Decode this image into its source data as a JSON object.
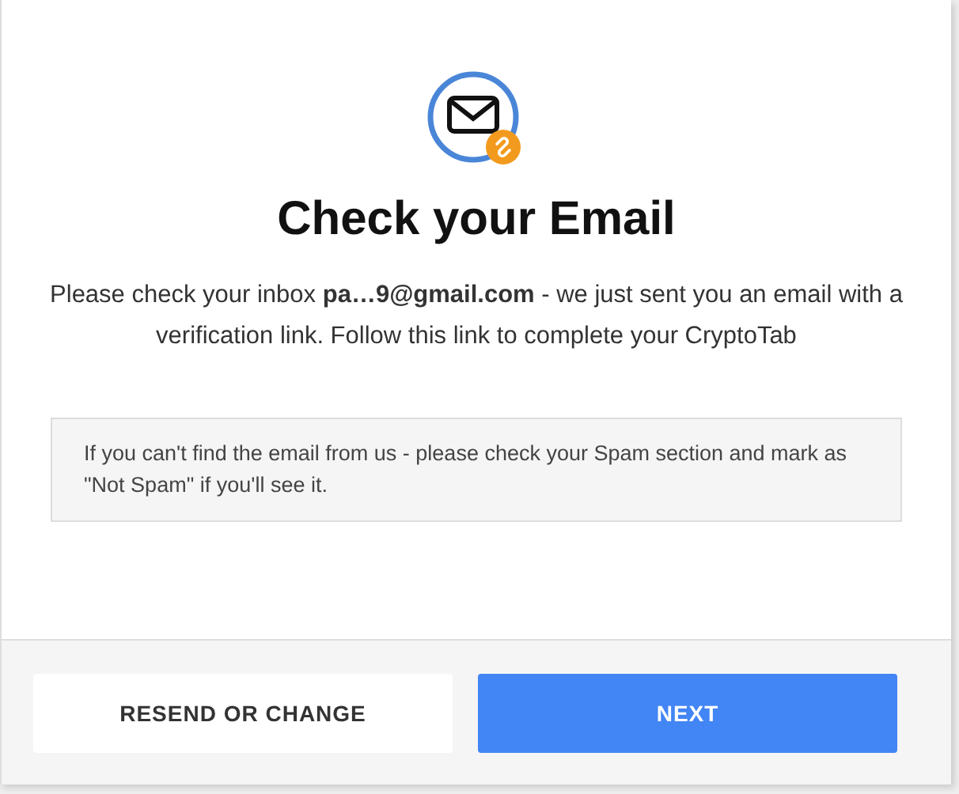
{
  "title": "Check your Email",
  "message": "Please check your inbox **pa…9@gmail.com** - we just sent you an email with a verification link. Follow this link to complete your CryptoTab",
  "notice": "If you can't find the email from us - please check your Spam section and mark as \"Not Spam\" if you'll see it.",
  "buttons": [
    {
      "label": "RESEND OR CHANGE",
      "kind": "secondary"
    },
    {
      "label": "NEXT",
      "kind": "primary"
    }
  ]
}
